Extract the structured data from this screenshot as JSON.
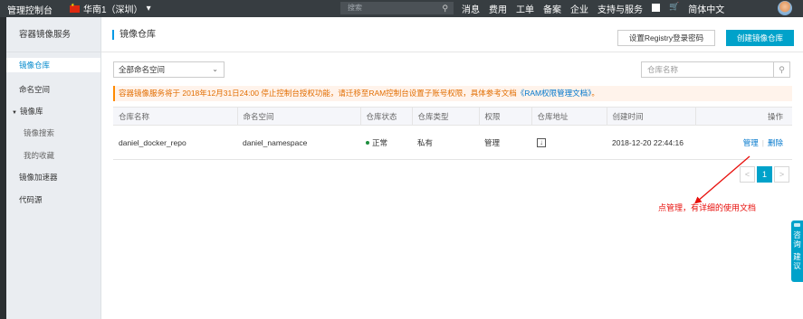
{
  "topbar": {
    "brand": "管理控制台",
    "region": "华南1（深圳）",
    "region_chevron": "▾",
    "search_placeholder": "搜索",
    "nav": [
      "消息",
      "费用",
      "工单",
      "备案",
      "企业",
      "支持与服务"
    ],
    "icons": [
      "terminal-icon",
      "cart-icon"
    ],
    "language": "简体中文"
  },
  "sidebar": {
    "title": "容器镜像服务",
    "items": [
      {
        "label": "镜像仓库",
        "active": true
      },
      {
        "label": "命名空间"
      },
      {
        "label": "镜像库",
        "expanded": true
      },
      {
        "label": "镜像搜索"
      },
      {
        "label": "我的收藏"
      },
      {
        "label": "镜像加速器"
      },
      {
        "label": "代码源"
      }
    ]
  },
  "header": {
    "title": "镜像仓库",
    "registry_button": "设置Registry登录密码",
    "create_button": "创建镜像仓库"
  },
  "filters": {
    "namespace_select": "全部命名空间",
    "repo_search_placeholder": "仓库名称"
  },
  "notice": {
    "text": "容器镜像服务将于 2018年12月31日24:00 停止控制台授权功能，请迁移至RAM控制台设置子账号权限，具体参考文档",
    "link": "《RAM权限管理文档》",
    "tail": "。"
  },
  "table": {
    "columns": [
      "仓库名称",
      "命名空间",
      "仓库状态",
      "仓库类型",
      "权限",
      "仓库地址",
      "创建时间",
      "操作"
    ],
    "rows": [
      {
        "name": "daniel_docker_repo",
        "namespace": "daniel_namespace",
        "status": "正常",
        "type": "私有",
        "permission": "管理",
        "address_icon": "download-icon",
        "created": "2018-12-20 22:44:16",
        "op_manage": "管理",
        "op_sep": "|",
        "op_delete": "删除"
      }
    ]
  },
  "pagination": {
    "prev": "<",
    "current": "1",
    "next": ">"
  },
  "annotation": "点管理，有详细的使用文档",
  "float_tab": {
    "line1": "咨询",
    "line2": "建议"
  },
  "colors": {
    "accent": "#00a2ca",
    "link": "#0077cc",
    "annotation": "#e8100c",
    "notice_text": "#e26d00"
  }
}
